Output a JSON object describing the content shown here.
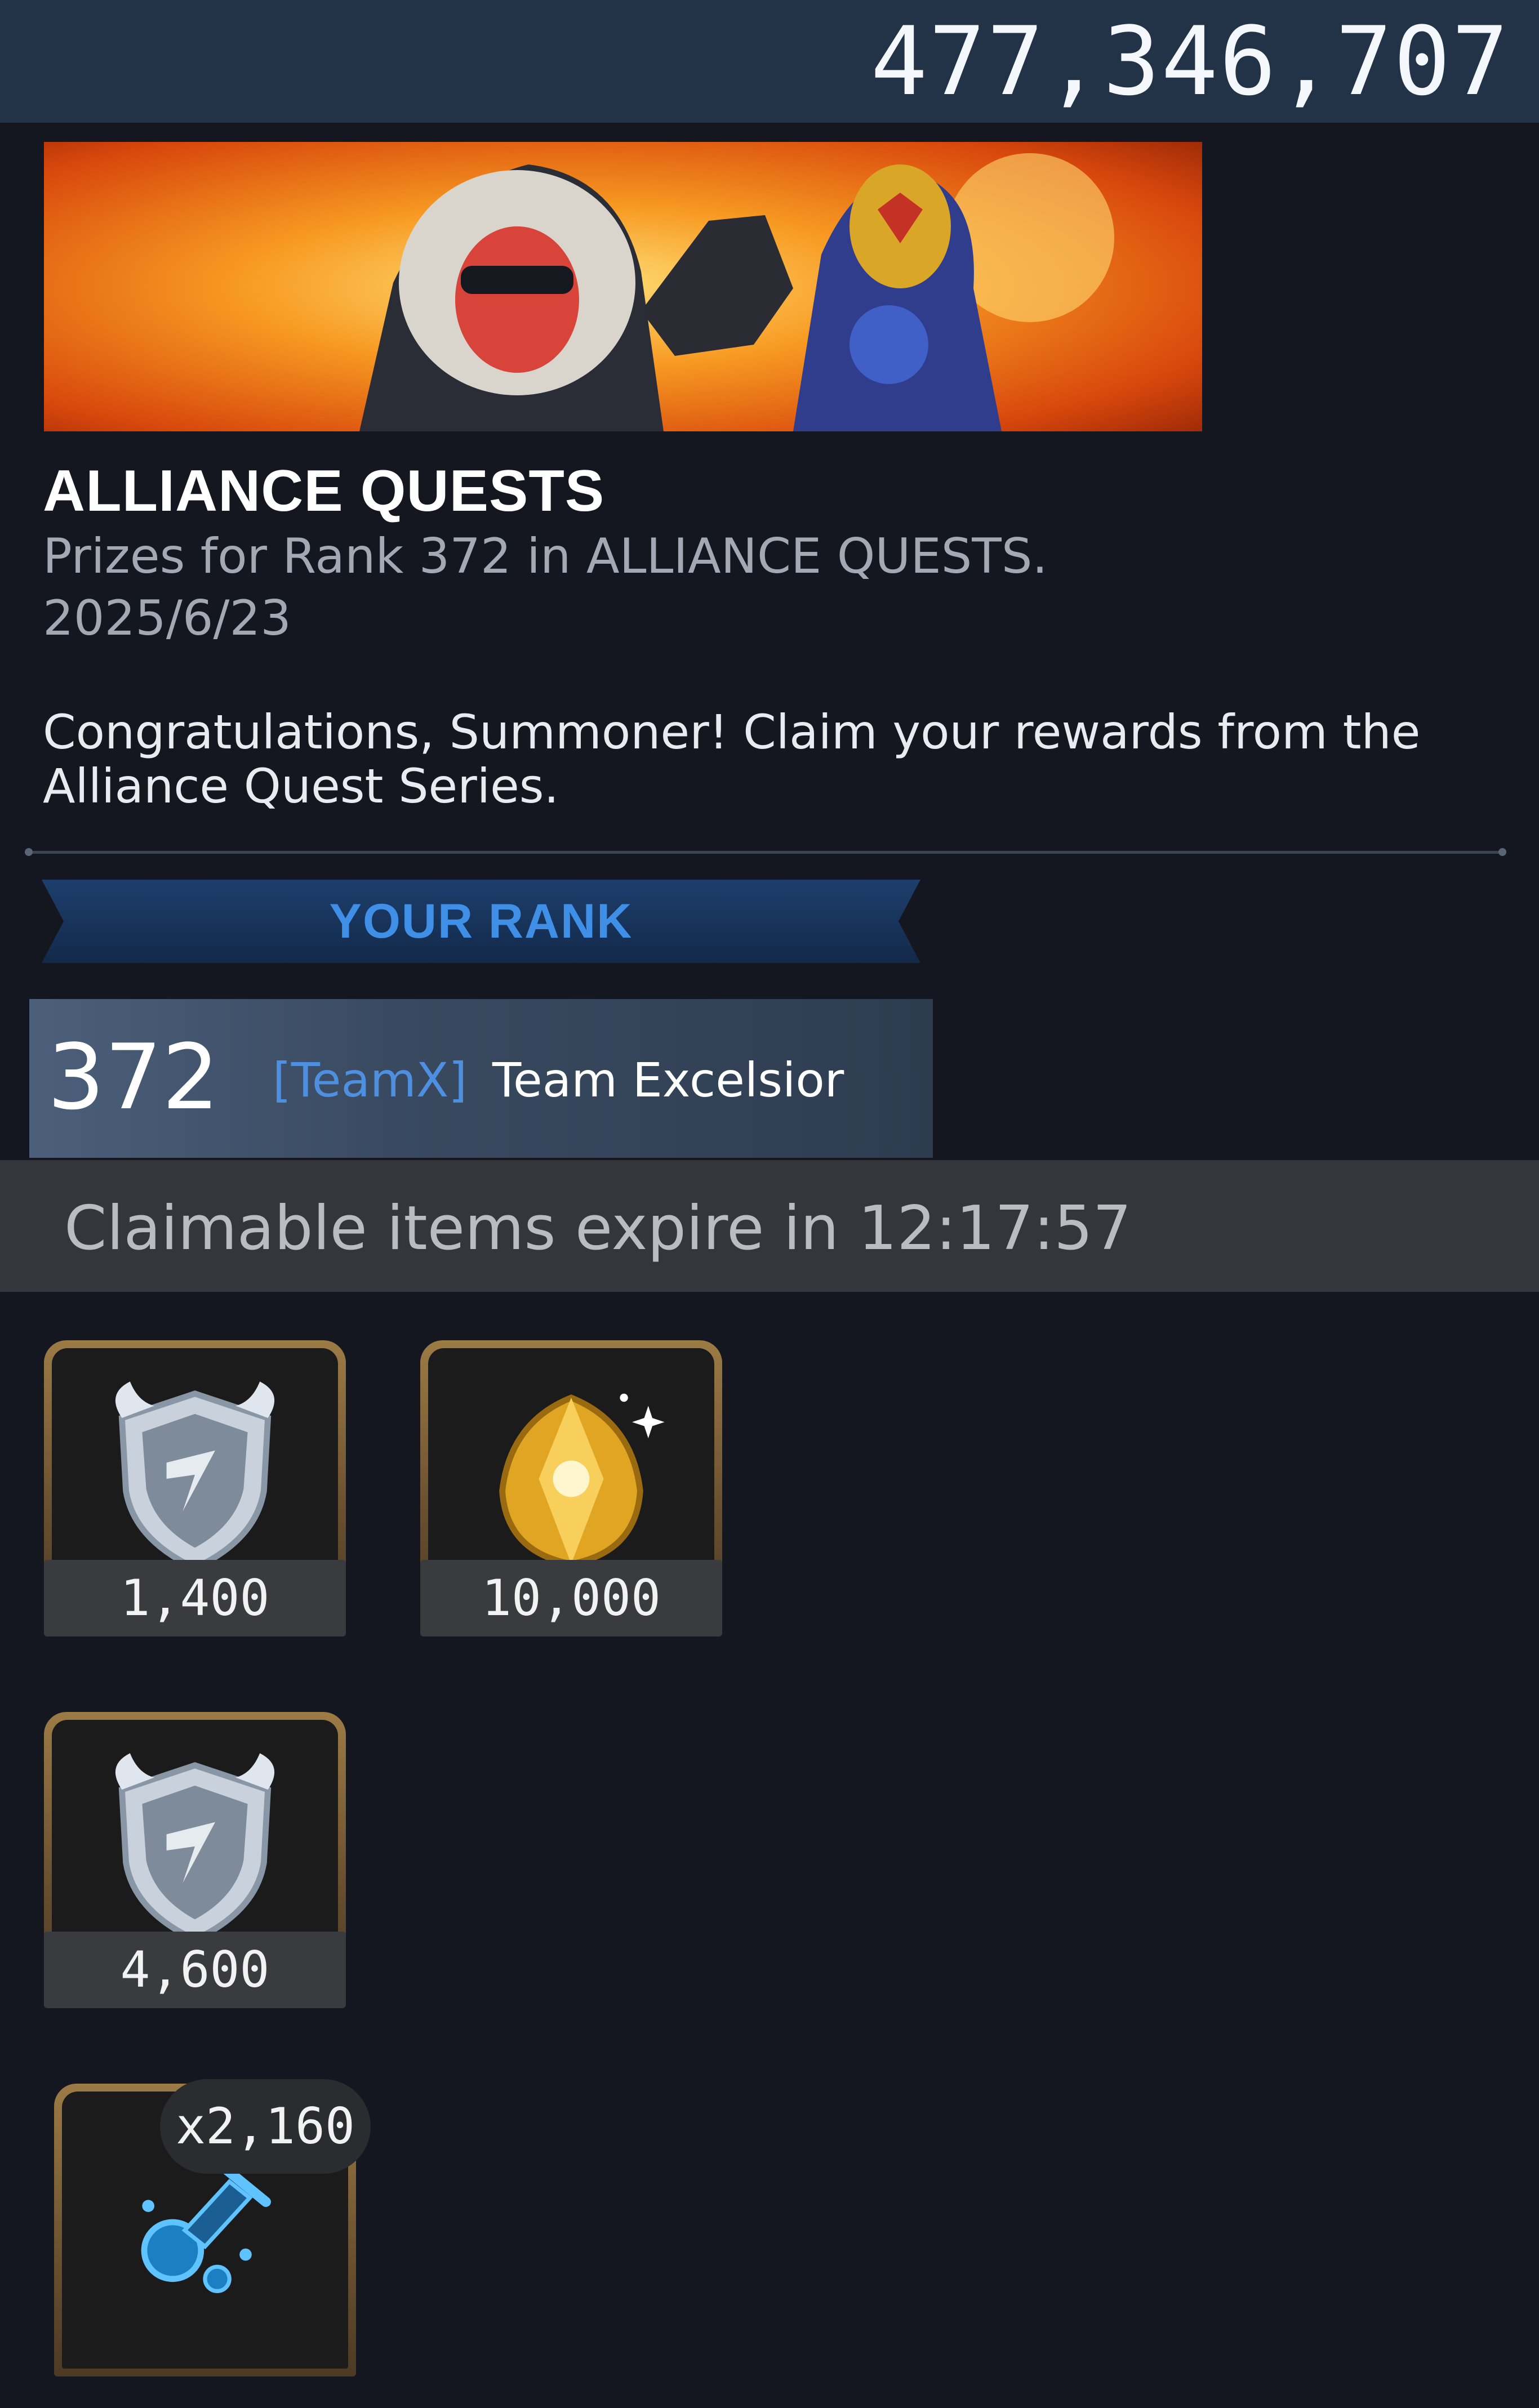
{
  "header": {
    "currency_amount": "477,346,707"
  },
  "quest": {
    "title": "ALLIANCE QUESTS",
    "subtitle": "Prizes for Rank 372 in ALLIANCE QUESTS.",
    "date": "2025/6/23",
    "message": "Congratulations, Summoner! Claim your rewards from the Alliance Quest Series."
  },
  "rank": {
    "section_label": "YOUR RANK",
    "number": "372",
    "team_tag": "[TeamX]",
    "team_name": "Team Excelsior"
  },
  "expire": {
    "text": "Claimable items expire in 12:17:57"
  },
  "rewards": [
    {
      "icon": "alliance-shield-icon",
      "quantity": "1,400"
    },
    {
      "icon": "gold-crystal-icon",
      "quantity": "10,000"
    },
    {
      "icon": "alliance-shield-icon",
      "quantity": "4,600"
    },
    {
      "icon": "blue-potion-icon",
      "quantity": "x2,160"
    }
  ],
  "colors": {
    "background": "#141720",
    "topbar": "#233347",
    "rank_ribbon_text": "#3f8fe6",
    "team_tag": "#4f8fe0",
    "frame_gold": "#9c7b45"
  }
}
